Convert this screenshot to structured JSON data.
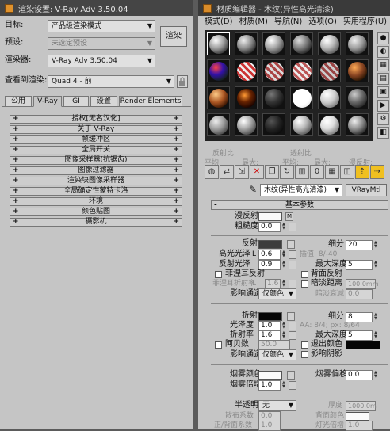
{
  "render_setup": {
    "title": "渲染设置: V-Ray Adv 3.50.04",
    "target_label": "目标:",
    "target_value": "产品级渲染模式",
    "preset_label": "预设:",
    "preset_value": "未选定预设",
    "renderer_label": "渲染器:",
    "renderer_value": "V-Ray Adv 3.50.04",
    "render_button": "渲染",
    "view_label": "查看到渲染:",
    "view_value": "Quad 4 - 前",
    "tabs": [
      "公用",
      "V-Ray",
      "GI",
      "设置",
      "Render Elements"
    ],
    "rollouts": [
      "授权[无名汉化]",
      "关于 V-Ray",
      "帧缓冲区",
      "全局开关",
      "图像采样器(抗锯齿)",
      "图像过滤器",
      "渲染块图像采样器",
      "全局确定性蒙特卡洛",
      "环境",
      "颜色贴图",
      "摄影机"
    ]
  },
  "material_editor": {
    "title": "材质编辑器 - 木纹(异性高光清漆)",
    "menu": [
      "模式(D)",
      "材质(M)",
      "导航(N)",
      "选项(O)",
      "实用程序(U)"
    ],
    "faint_labels": {
      "reflect_l": "反射比",
      "reflect_r": "透射比",
      "avg": "平均:",
      "max": "最大:",
      "avg2": "平均:",
      "max2": "最大:",
      "diffuse": "漫反射:",
      "diffuse_max": "最"
    },
    "material_name": "木纹(异性高光清漆)",
    "material_type": "VRayMtl",
    "rollout_title": "基本参数",
    "diffuse": {
      "label": "漫反射",
      "roughness_label": "粗糙度",
      "roughness": "0.0",
      "map_btn": "M"
    },
    "reflection": {
      "label": "反射",
      "glossiness_label": "高光光泽",
      "glossiness": "0.6",
      "refl_gloss_label": "反射光泽",
      "refl_gloss": "0.9",
      "fresnel_label": "菲涅耳反射",
      "fresnel_ior_label": "菲涅耳折射率",
      "fresnel_ior": "1.6",
      "affect_label": "影响通道",
      "affect_value": "仅颜色",
      "subdivs_label": "细分",
      "subdivs": "20",
      "interp_label": "插值: 8/-40",
      "max_depth_label": "最大深度",
      "max_depth": "5",
      "back_label": "背面反射",
      "dim_label": "暗淡距离",
      "dim_value": "100.0mm",
      "dim_falloff_label": "暗淡衰减",
      "dim_falloff": "0.0"
    },
    "refraction": {
      "label": "折射",
      "glossiness_label": "光泽度",
      "glossiness": "1.0",
      "ior_label": "折射率",
      "ior": "1.6",
      "abbe_label": "阿贝数",
      "abbe": "50.0",
      "affect_label": "影响通道",
      "affect_value": "仅颜色",
      "subdivs_label": "细分",
      "subdivs": "8",
      "aa_label": "AA: 8/4; px: 8/64",
      "max_depth_label": "最大深度",
      "max_depth": "5",
      "exit_label": "退出颜色",
      "shadow_label": "影响阴影"
    },
    "fog": {
      "color_label": "烟雾颜色",
      "mult_label": "烟雾倍增",
      "mult": "1.0",
      "bias_label": "烟雾偏移",
      "bias": "0.0"
    },
    "translucency": {
      "label": "半透明",
      "value": "无",
      "thickness_label": "厚度",
      "thickness": "1000.0m",
      "scatter_label": "散布系数",
      "scatter": "0.0",
      "back_label": "背面颜色",
      "fwd_label": "正/背面系数",
      "fwd": "1.0",
      "light_label": "灯光倍增",
      "light": "1.0"
    }
  },
  "colors": {
    "panel": "#c5c5c5",
    "title_bar": "#454545",
    "desktop": "#5b5b5b",
    "highlight_yellow": "#f0c020"
  }
}
